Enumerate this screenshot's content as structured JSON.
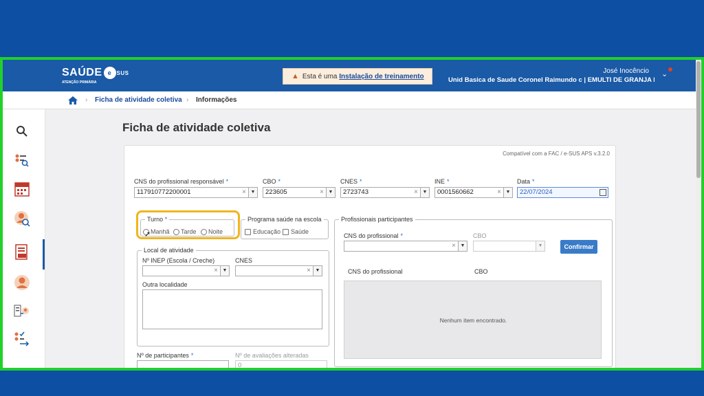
{
  "header": {
    "logo": "SAÚDE",
    "logo_badge": "e",
    "logo_badge_suffix": "SUS",
    "logo_subtitle": "ATENÇÃO PRIMÁRIA",
    "warning_prefix": "Esta é uma",
    "warning_link": "Instalação de treinamento",
    "user_name": "José Inocêncio",
    "unit": "Unid Basica de Saude Coronel Raimundo c | EMULTI DE GRANJA I"
  },
  "breadcrumb": {
    "item1": "Ficha de atividade coletiva",
    "item2": "Informações"
  },
  "page": {
    "title": "Ficha de atividade coletiva",
    "compat": "Compatível com a FAC / e-SUS APS v.3.2.0"
  },
  "form": {
    "cns_label": "CNS do profissional responsável",
    "cns_value": "117910772200001",
    "cbo_label": "CBO",
    "cbo_value": "223605",
    "cnes_label": "CNES",
    "cnes_value": "2723743",
    "ine_label": "INE",
    "ine_value": "0001560662",
    "data_label": "Data",
    "data_value": "22/07/2024",
    "turno_legend": "Turno",
    "turno_options": [
      "Manhã",
      "Tarde",
      "Noite"
    ],
    "pse_legend": "Programa saúde na escola",
    "pse_options": [
      "Educação",
      "Saúde"
    ],
    "local_legend": "Local de atividade",
    "inep_label": "Nº INEP (Escola / Creche)",
    "local_cnes_label": "CNES",
    "outra_label": "Outra localidade",
    "participantes_label": "Nº de participantes",
    "avaliacoes_label": "Nº de avaliações alteradas",
    "avaliacoes_value": "0"
  },
  "profissionais": {
    "legend": "Profissionais participantes",
    "cns_label": "CNS do profissional",
    "cbo_label": "CBO",
    "confirm_label": "Confirmar",
    "col_cns": "CNS do profissional",
    "col_cbo": "CBO",
    "empty_text": "Nenhum item encontrado."
  },
  "colors": {
    "brand": "#1a5aa6",
    "outer_bg": "#0d4fa3",
    "frame_border": "#22d02a",
    "highlight": "#f0b51e",
    "required": "#2a6fd0"
  },
  "icons": [
    "search-icon",
    "list-search-icon",
    "calendar-icon",
    "user-search-icon",
    "document-cds-icon",
    "person-icon",
    "transfer-icon",
    "checklist-arrow-icon",
    "home-icon"
  ]
}
